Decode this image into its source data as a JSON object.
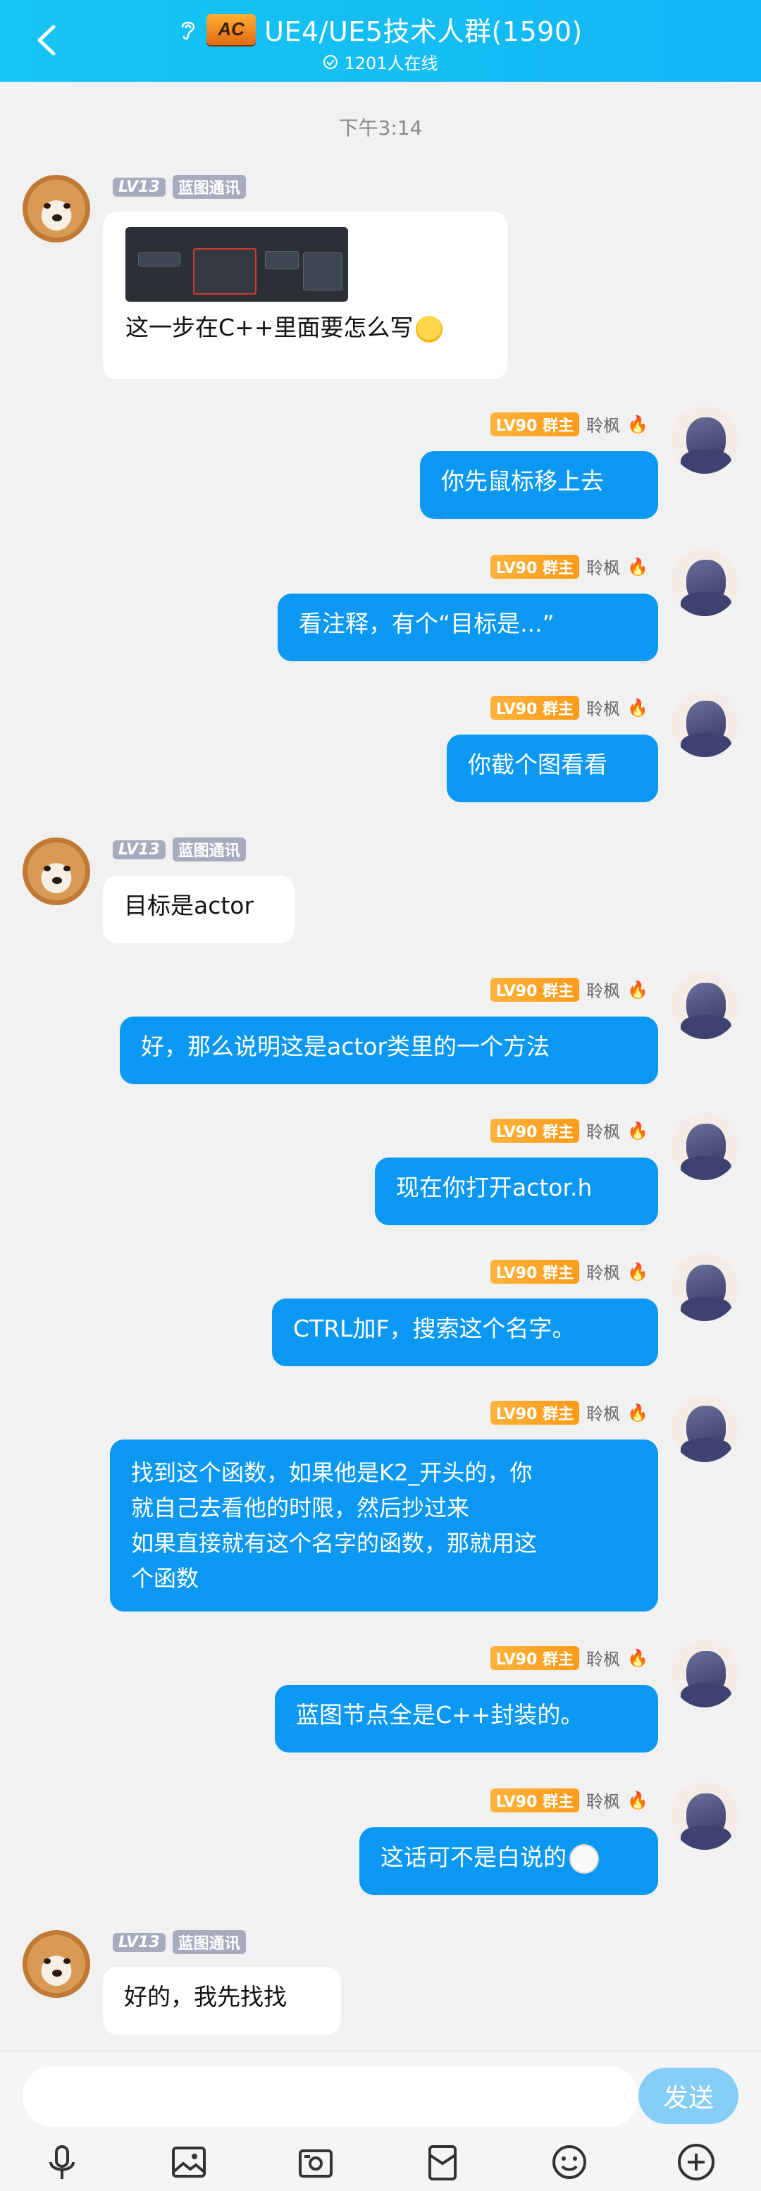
{
  "header": {
    "title": "UE4/UE5技术人群(1590)",
    "online": "1201人在线",
    "logo_text": "AC"
  },
  "time_label": "下午3:14",
  "messages": [
    {
      "side": "left",
      "level": "LV13",
      "name": "蓝图通讯",
      "text": "这一步在C++里面要怎么写",
      "has_image": true,
      "emoji": "laugh"
    },
    {
      "side": "right",
      "level": "LV90",
      "role": "群主",
      "name": "聆枫",
      "text": "你先鼠标移上去"
    },
    {
      "side": "right",
      "level": "LV90",
      "role": "群主",
      "name": "聆枫",
      "text": "看注释，有个“目标是...”"
    },
    {
      "side": "right",
      "level": "LV90",
      "role": "群主",
      "name": "聆枫",
      "text": "你截个图看看"
    },
    {
      "side": "left",
      "level": "LV13",
      "name": "蓝图通讯",
      "text": "目标是actor"
    },
    {
      "side": "right",
      "level": "LV90",
      "role": "群主",
      "name": "聆枫",
      "text": "好，那么说明这是actor类里的一个方法"
    },
    {
      "side": "right",
      "level": "LV90",
      "role": "群主",
      "name": "聆枫",
      "text": "现在你打开actor.h"
    },
    {
      "side": "right",
      "level": "LV90",
      "role": "群主",
      "name": "聆枫",
      "text": "CTRL加F，搜索这个名字。"
    },
    {
      "side": "right",
      "level": "LV90",
      "role": "群主",
      "name": "聆枫",
      "lines": [
        "找到这个函数，如果他是K2_开头的，你",
        "就自己去看他的时限，然后抄过来",
        "如果直接就有这个名字的函数，那就用这",
        "个函数"
      ]
    },
    {
      "side": "right",
      "level": "LV90",
      "role": "群主",
      "name": "聆枫",
      "text": "蓝图节点全是C++封装的。"
    },
    {
      "side": "right",
      "level": "LV90",
      "role": "群主",
      "name": "聆枫",
      "text": "这话可不是白说的",
      "emoji": "cat"
    },
    {
      "side": "left",
      "level": "LV13",
      "name": "蓝图通讯",
      "text": "好的，我先找找"
    }
  ],
  "input": {
    "placeholder": "",
    "send_label": "发送"
  },
  "toolbar": [
    "microphone-icon",
    "image-icon",
    "camera-icon",
    "red-packet-icon",
    "emoji-icon",
    "plus-icon"
  ],
  "colors": {
    "header": "#12b6f5",
    "bubble_self": "#0a98f2",
    "send_button": "#86cdf8",
    "owner_badge": "#ffa726"
  }
}
